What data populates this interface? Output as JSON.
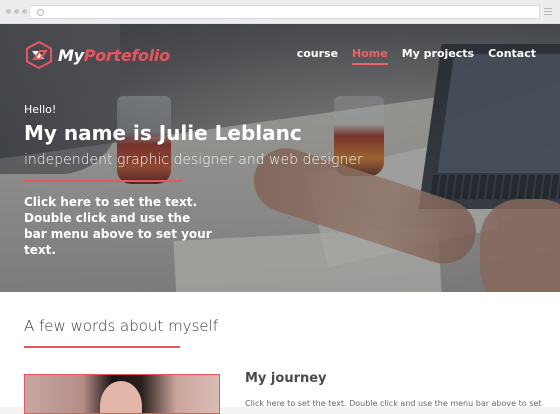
{
  "browser": {
    "menu_icon": "hamburger-icon",
    "dot_icons": [
      "window-dot",
      "window-dot",
      "window-dot"
    ]
  },
  "logo": {
    "prefix": "My",
    "accent": "Portefolio",
    "icon": "logo-mark-icon"
  },
  "nav": {
    "items": [
      {
        "label": "course",
        "active": false
      },
      {
        "label": "Home",
        "active": true
      },
      {
        "label": "My projects",
        "active": false
      },
      {
        "label": "Contact",
        "active": false
      }
    ]
  },
  "hero": {
    "greeting": "Hello!",
    "title": "My name is Julie Leblanc",
    "subtitle": "independent graphic designer and web designer",
    "body": "Click here to set the text. Double click and use the bar menu above to set your text."
  },
  "about": {
    "title": "A few words about myself",
    "journey_title": "My journey",
    "journey_text": "Click here to set the text. Double click and use the menu bar above to set"
  },
  "colors": {
    "accent": "#e8555f",
    "nav_active": "#f0616b",
    "text_dark": "#3d3d3d"
  }
}
